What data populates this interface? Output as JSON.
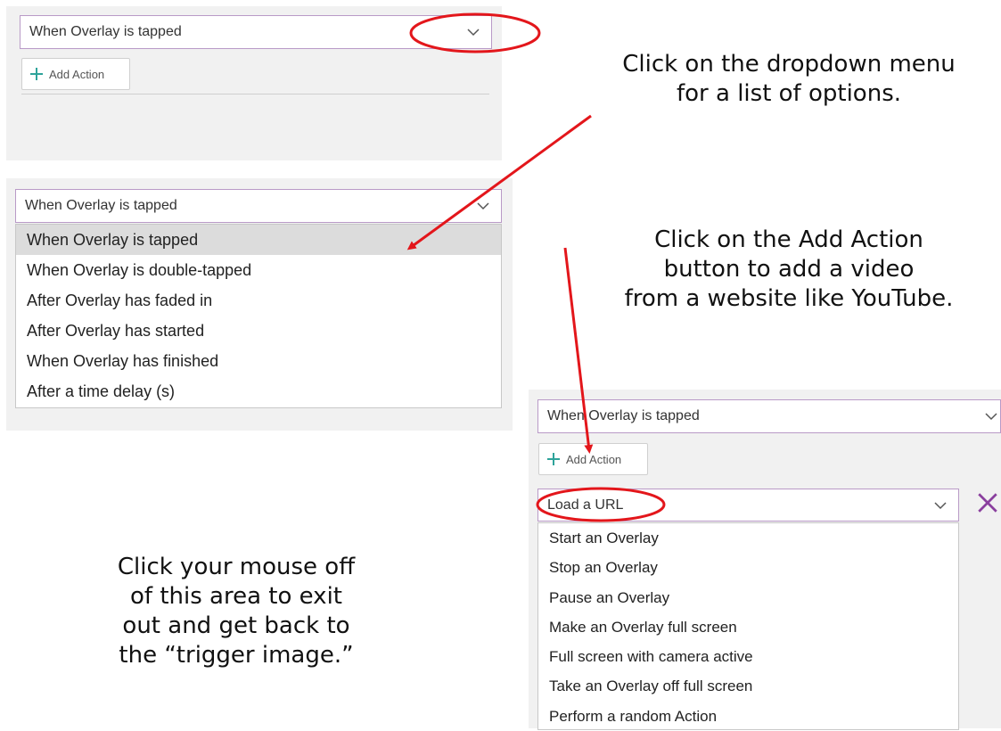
{
  "panel1": {
    "trigger_select": "When Overlay is tapped",
    "add_action": "Add Action"
  },
  "panel2": {
    "trigger_select": "When Overlay is tapped",
    "options": [
      "When Overlay is tapped",
      "When Overlay is double-tapped",
      "After Overlay has faded in",
      "After Overlay has started",
      "When Overlay has finished",
      "After a time delay (s)"
    ],
    "selected_index": 0
  },
  "panel3": {
    "trigger_select": "When Overlay is tapped",
    "add_action": "Add Action",
    "action_select": "Load a URL",
    "action_options": [
      "Start an Overlay",
      "Stop an Overlay",
      "Pause an Overlay",
      "Make an Overlay full screen",
      "Full screen with camera active",
      "Take an Overlay off full screen",
      "Perform a random Action"
    ]
  },
  "notes": {
    "dropdown": [
      "Click on the dropdown menu",
      "for a list of options."
    ],
    "add_action": [
      "Click on the Add Action",
      "button to add a video",
      "from a website like YouTube."
    ],
    "exit": [
      "Click your mouse off",
      "of this area to exit",
      "out and get back to",
      "the “trigger image.”"
    ]
  },
  "colors": {
    "annotation_red": "#e3161b",
    "plus_teal": "#2ea39a",
    "select_border": "#b99ac7",
    "close_purple": "#8a3f9e"
  },
  "icons": [
    "chevron-down-icon",
    "plus-icon",
    "close-icon"
  ]
}
